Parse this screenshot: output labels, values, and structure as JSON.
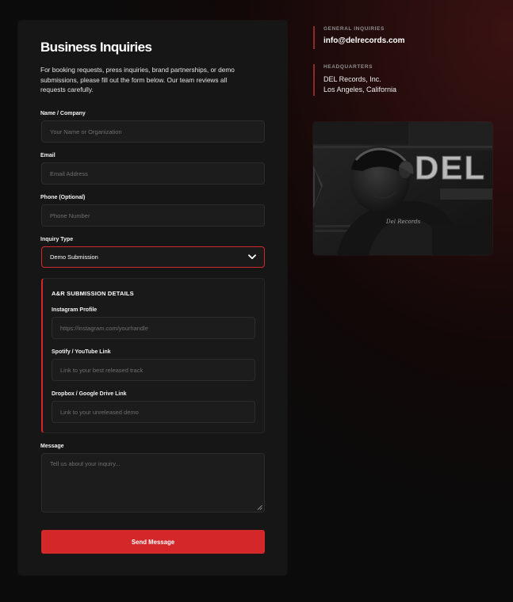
{
  "form": {
    "title": "Business Inquiries",
    "intro": "For booking requests, press inquiries, brand partnerships, or demo submissions, please fill out the form below. Our team reviews all requests carefully.",
    "name": {
      "label": "Name / Company",
      "placeholder": "Your Name or Organization"
    },
    "email": {
      "label": "Email",
      "placeholder": "Email Address"
    },
    "phone": {
      "label": "Phone (Optional)",
      "placeholder": "Phone Number"
    },
    "inquiry_type": {
      "label": "Inquiry Type",
      "selected": "Demo Submission"
    },
    "ar_section": {
      "title": "A&R SUBMISSION DETAILS",
      "instagram": {
        "label": "Instagram Profile",
        "placeholder": "https://instagram.com/yourhandle"
      },
      "spotify": {
        "label": "Spotify / YouTube Link",
        "placeholder": "Link to your best released track"
      },
      "dropbox": {
        "label": "Dropbox / Google Drive Link",
        "placeholder": "Link to your unreleased demo"
      }
    },
    "message": {
      "label": "Message",
      "placeholder": "Tell us about your inquiry..."
    },
    "submit_label": "Send Message"
  },
  "contact": {
    "general_label": "GENERAL INQUIRIES",
    "general_email": "info@delrecords.com",
    "hq_label": "HEADQUARTERS",
    "hq_line1": "DEL Records, Inc.",
    "hq_line2": "Los Angeles, California"
  },
  "photo": {
    "wall_text": "DEL",
    "shirt_text": "Del Records"
  },
  "colors": {
    "accent": "#d4272a",
    "card_bg": "#161616",
    "field_bg": "#1c1c1c"
  },
  "icons": {
    "select_arrow": "chevron-down-icon",
    "resize": "resize-grip-icon"
  }
}
